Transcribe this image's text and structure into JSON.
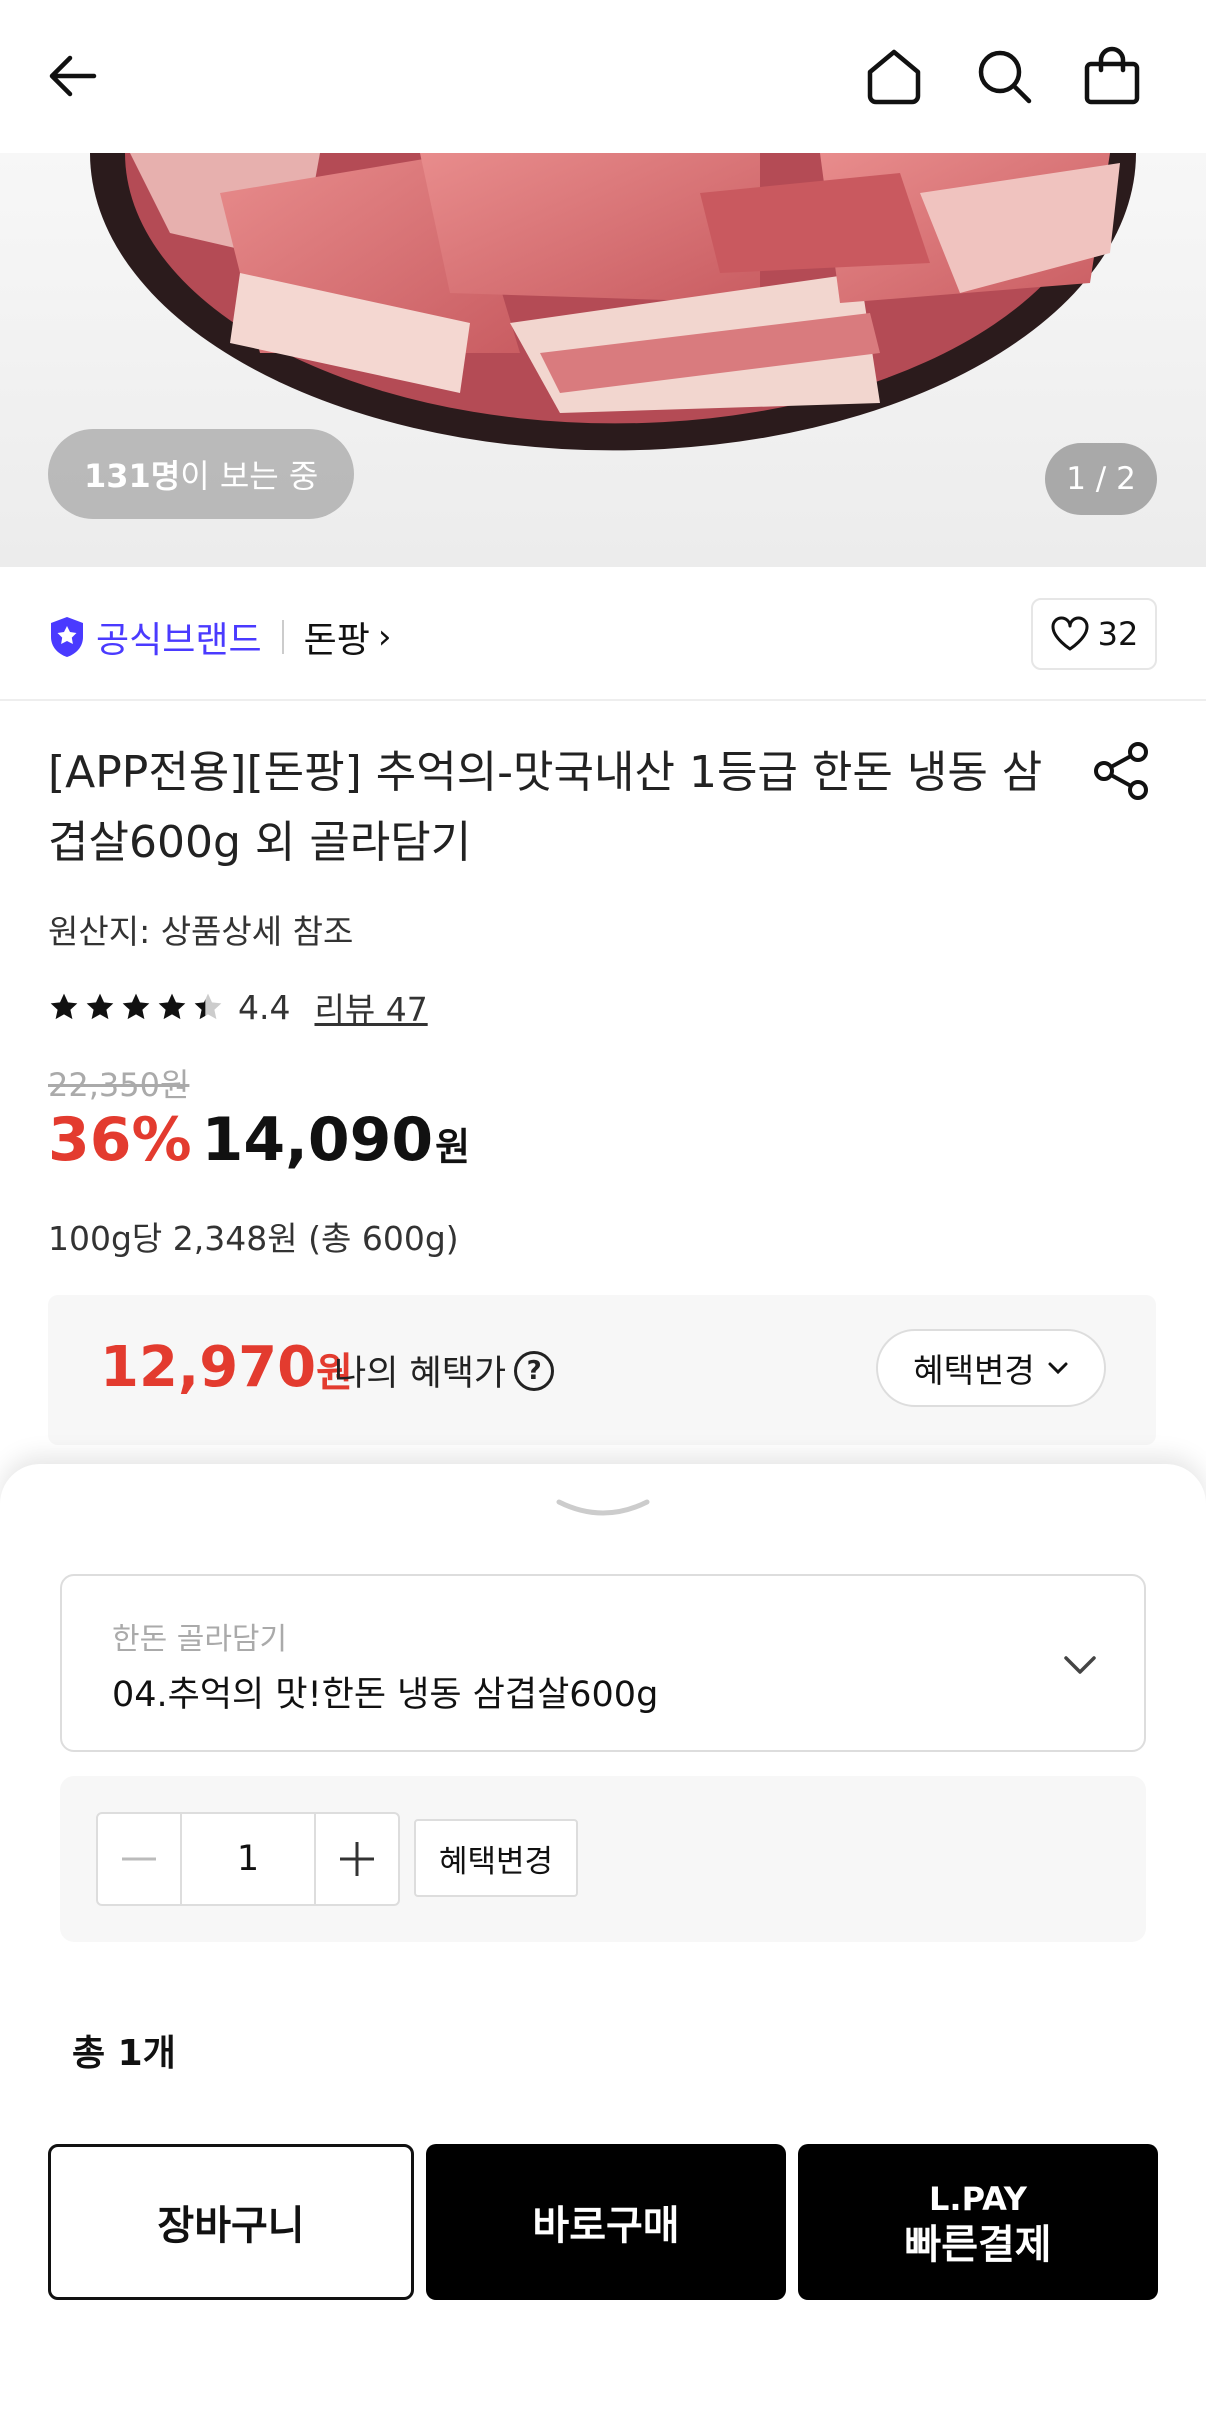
{
  "hero": {
    "viewers_count": "131명",
    "viewers_suffix": "이 보는 중",
    "pager": "1 / 2"
  },
  "brand": {
    "official_label": "공식브랜드",
    "store_name": "돈팡",
    "chevron": "›",
    "like_count": "32"
  },
  "product": {
    "title": "[APP전용][돈팡] 추억의-맛국내산 1등급 한돈 냉동 삼겹살600g 외 골라담기",
    "origin": "원산지: 상품상세 참조",
    "rating": 4.4,
    "rating_text": "4.4",
    "review_link": "리뷰 47",
    "original_price": "22,350원",
    "discount": "36%",
    "price": "14,090",
    "price_unit": "원",
    "unit_price": "100g당 2,348원 (총 600g)"
  },
  "benefit": {
    "price": "12,970",
    "price_unit": "원",
    "label": "나의 혜택가",
    "help": "?",
    "change_button": "혜택변경"
  },
  "sheet": {
    "option_label": "한돈 골라담기",
    "option_value": "04.추억의 맛!한돈 냉동 삼겹살600g",
    "quantity": "1",
    "benefit_change": "혜택변경",
    "total": "총 1개",
    "cart_button": "장바구니",
    "buy_button": "바로구매",
    "lpay_line1": "L.PAY",
    "lpay_line2": "빠른결제"
  },
  "colors": {
    "accent_red": "#e33b2f",
    "brand_purple": "#4a3aff"
  },
  "icons": [
    "back-arrow-icon",
    "home-icon",
    "search-icon",
    "shopping-bag-icon",
    "official-badge-icon",
    "heart-icon",
    "share-icon",
    "star-icon",
    "help-icon",
    "chevron-down-icon",
    "minus-icon",
    "plus-icon"
  ]
}
